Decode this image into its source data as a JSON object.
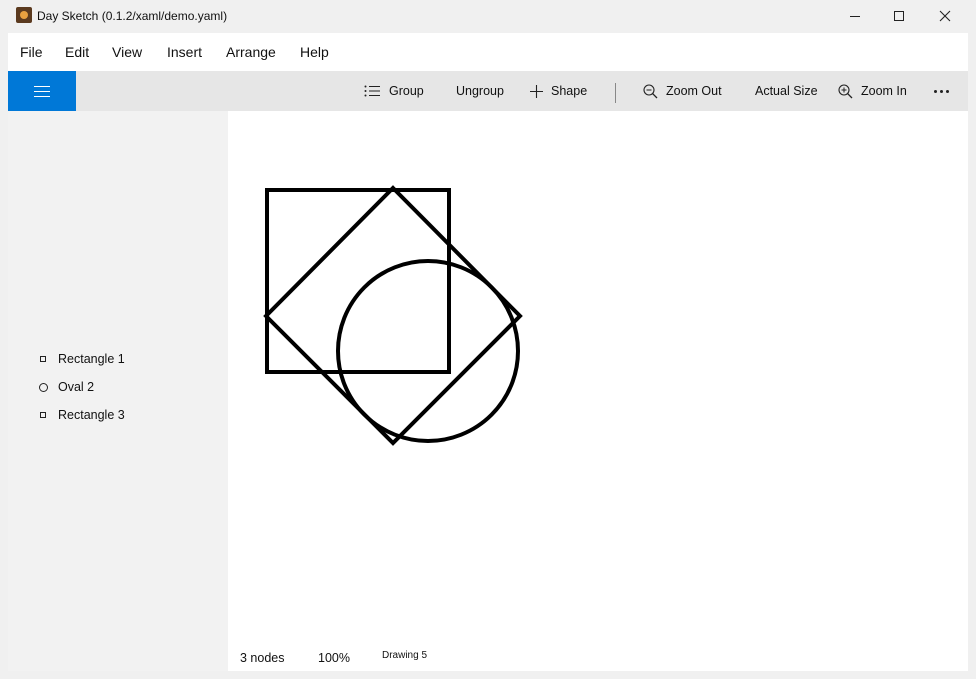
{
  "window": {
    "title": "Day Sketch (0.1.2/xaml/demo.yaml)"
  },
  "menu": {
    "items": [
      "File",
      "Edit",
      "View",
      "Insert",
      "Arrange",
      "Help"
    ]
  },
  "toolbar": {
    "group_label": "Group",
    "ungroup_label": "Ungroup",
    "shape_label": "Shape",
    "zoom_out_label": "Zoom Out",
    "actual_size_label": "Actual Size",
    "zoom_in_label": "Zoom In",
    "accent_color": "#0078d7"
  },
  "layers": [
    {
      "label": "Rectangle 1",
      "icon": "square-icon"
    },
    {
      "label": "Oval 2",
      "icon": "circle-icon"
    },
    {
      "label": "Rectangle 3",
      "icon": "square-icon"
    }
  ],
  "status": {
    "node_count": "3 nodes",
    "zoom": "100%",
    "drawing_name": "Drawing 5"
  }
}
